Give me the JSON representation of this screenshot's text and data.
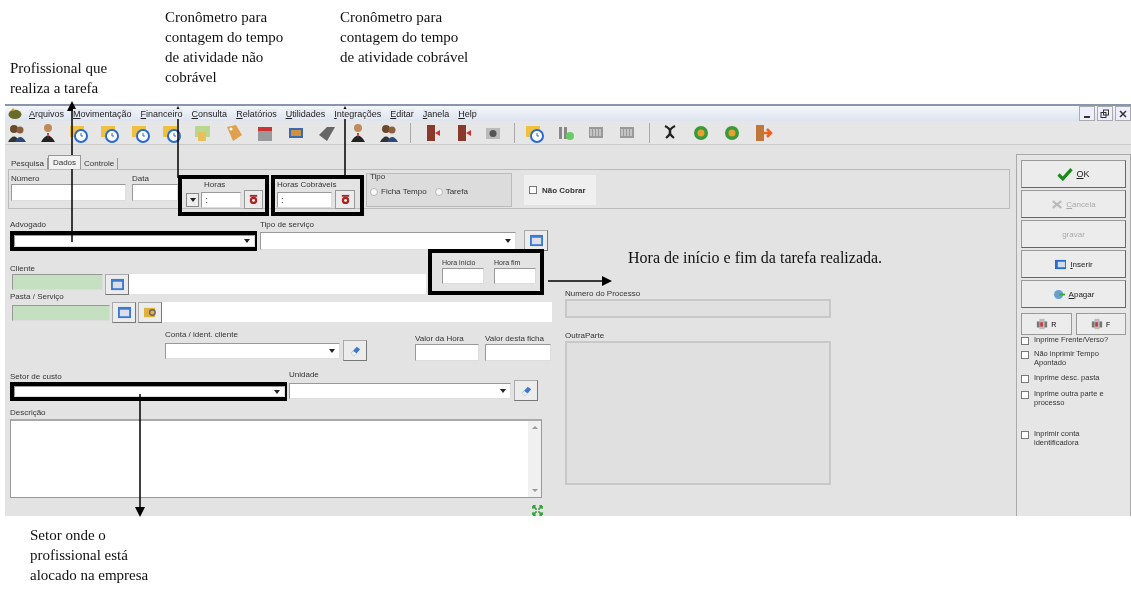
{
  "annotations": [
    {
      "text": "Profissional  que realiza a tarefa"
    },
    {
      "text": "Cronômetro para contagem do tempo de atividade não cobrável"
    },
    {
      "text": "Cronômetro para contagem do tempo de atividade cobrável"
    },
    {
      "text": "Hora de início e fim da tarefa realizada."
    },
    {
      "text": "Setor onde o profissional está alocado na empresa"
    }
  ],
  "menu": [
    "Arquivos",
    "Movimentação",
    "Financeiro",
    "Consulta",
    "Relatórios",
    "Utilidades",
    "Integrações",
    "Editar",
    "Janela",
    "Help"
  ],
  "tabs": [
    {
      "label": "Pesquisa",
      "selected": false
    },
    {
      "label": "Dados",
      "selected": true
    },
    {
      "label": "Controle",
      "selected": false
    }
  ],
  "fields": {
    "numero": "Número",
    "data": "Data",
    "horas": "Horas",
    "horas_value": ":",
    "horas_cobraveis": "Horas Cobráveis",
    "horas_cobraveis_value": ":",
    "tipo": "Tipo",
    "advogado": "Advogado",
    "tipo_servico": "Tipo de serviço",
    "cliente": "Cliente",
    "hora_inicio": "Hora início",
    "hora_fim": "Hora fim",
    "numero_processo": "Numero do Processo",
    "pasta": "Pasta / Serviço",
    "conta": "Conta / ident. cliente",
    "valor_hora": "Valor da Hora",
    "valor_ficha": "Valor desta ficha",
    "outra_parte": "OutraParte",
    "setor": "Setor de custo",
    "unidade": "Unidade",
    "descricao": "Descrição"
  },
  "tipo_options": [
    {
      "label": "Ficha Tempo",
      "selected": false
    },
    {
      "label": "Tarefa",
      "selected": false
    }
  ],
  "nao_cobrar": {
    "label": "Não Cobrar",
    "checked": false
  },
  "buttons": [
    {
      "label": "OK",
      "kind": "check",
      "disabled": false
    },
    {
      "label": "Cancela",
      "kind": "cancel",
      "disabled": true
    },
    {
      "label": "gravar",
      "kind": "plain",
      "disabled": true
    },
    {
      "label": "Inserir",
      "kind": "insert",
      "disabled": false
    },
    {
      "label": "Apagar",
      "kind": "delete",
      "disabled": false
    }
  ],
  "small_buttons": [
    "R",
    "F"
  ],
  "options": [
    {
      "label": "Inprime Frente/Verso?",
      "checked": false
    },
    {
      "label": "Não inprimir Tempo Apontado",
      "checked": false
    },
    {
      "label": "Inprime desc. pasta",
      "checked": false
    },
    {
      "label": "Inprime outra parte e processo",
      "checked": false
    },
    {
      "label": "Inprimir conta identificadora",
      "checked": false
    }
  ]
}
